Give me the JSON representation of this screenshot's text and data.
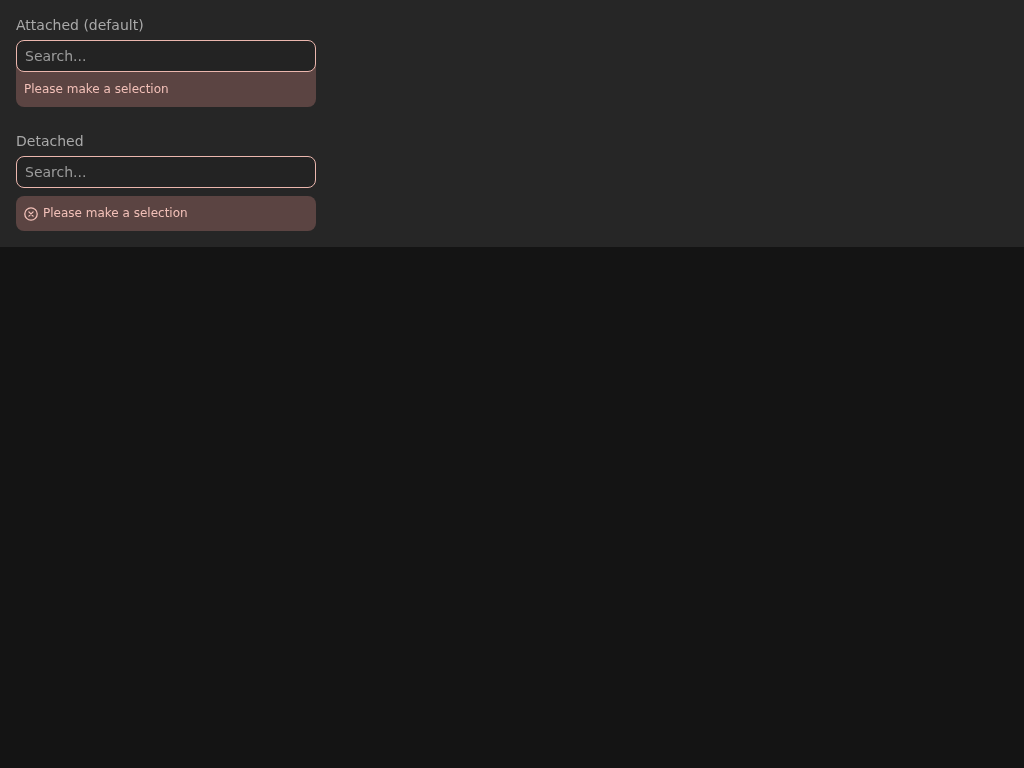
{
  "sections": [
    {
      "kind": "attached",
      "label": "Attached (default)",
      "search": {
        "placeholder": "Search..."
      },
      "error": "Please make a selection"
    },
    {
      "kind": "detached",
      "label": "Detached",
      "search": {
        "placeholder": "Search..."
      },
      "error": "Please make a selection"
    }
  ]
}
